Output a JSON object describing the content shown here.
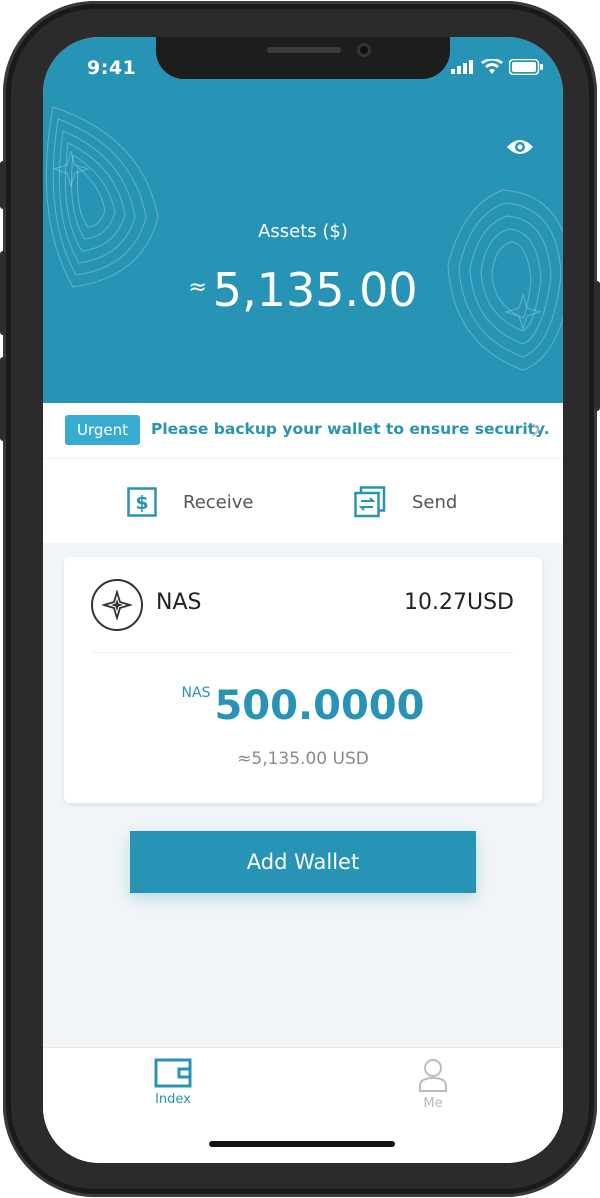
{
  "status_bar": {
    "time": "9:41"
  },
  "hero": {
    "assets_label": "Assets ($)",
    "approx_symbol": "≈",
    "assets_amount": "5,135.00",
    "bg_color": "#2894b5"
  },
  "notice": {
    "badge": "Urgent",
    "message": "Please backup your wallet to ensure security."
  },
  "actions": {
    "receive_label": "Receive",
    "send_label": "Send"
  },
  "wallet_card": {
    "token_name": "NAS",
    "token_price": "10.27USD",
    "balance_unit": "NAS",
    "balance_value": "500.0000",
    "balance_usd": "≈5,135.00 USD"
  },
  "add_wallet_label": "Add Wallet",
  "tabbar": {
    "tabs": [
      {
        "label": "Index",
        "icon": "wallet-icon",
        "active": true
      },
      {
        "label": "Me",
        "icon": "person-icon",
        "active": false
      }
    ]
  },
  "colors": {
    "accent": "#2894b5",
    "badge": "#38acd0"
  }
}
